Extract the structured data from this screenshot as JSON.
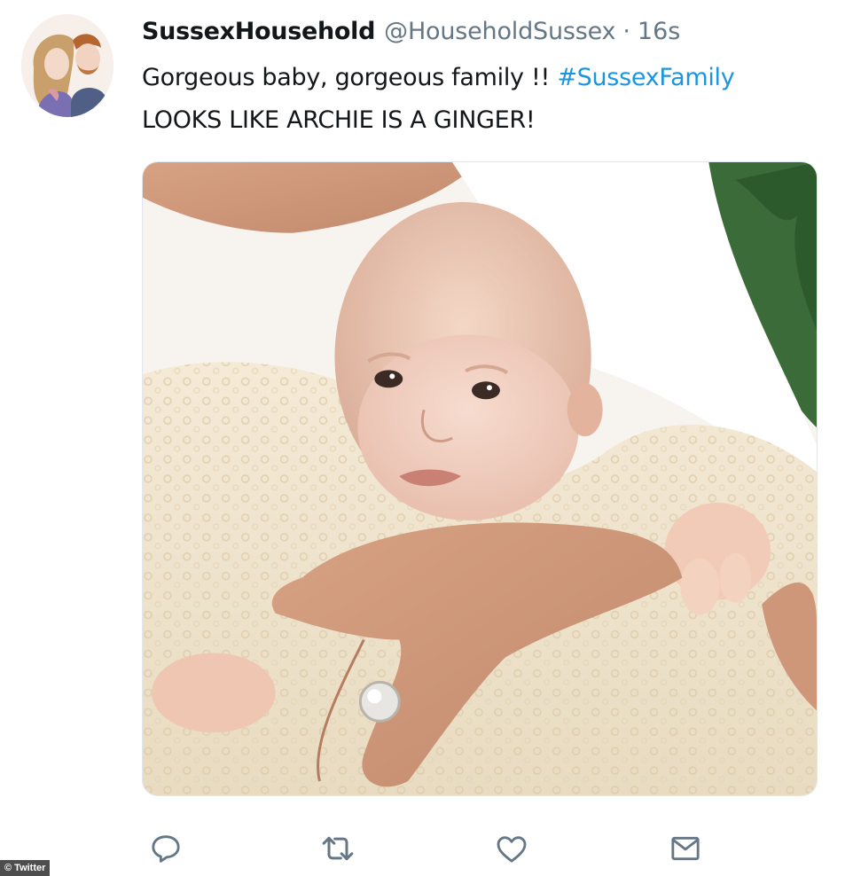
{
  "tweet": {
    "display_name": "SussexHousehold",
    "handle": "@HouseholdSussex",
    "separator": "·",
    "timestamp": "16s",
    "text_line1": "Gorgeous baby, gorgeous family  !! ",
    "hashtag": "#SussexFamily",
    "text_line2": "LOOKS LIKE ARCHIE IS A GINGER!"
  },
  "avatar": {
    "icon": "profile-illustration-couple"
  },
  "media": {
    "icon": "photo-baby-in-lace-gown"
  },
  "actions": [
    {
      "icon": "reply-icon"
    },
    {
      "icon": "retweet-icon"
    },
    {
      "icon": "like-icon"
    },
    {
      "icon": "message-icon"
    }
  ],
  "credit": "© Twitter",
  "colors": {
    "text": "#14171a",
    "secondary": "#657786",
    "link": "#1b95e0",
    "icon": "#657786"
  }
}
